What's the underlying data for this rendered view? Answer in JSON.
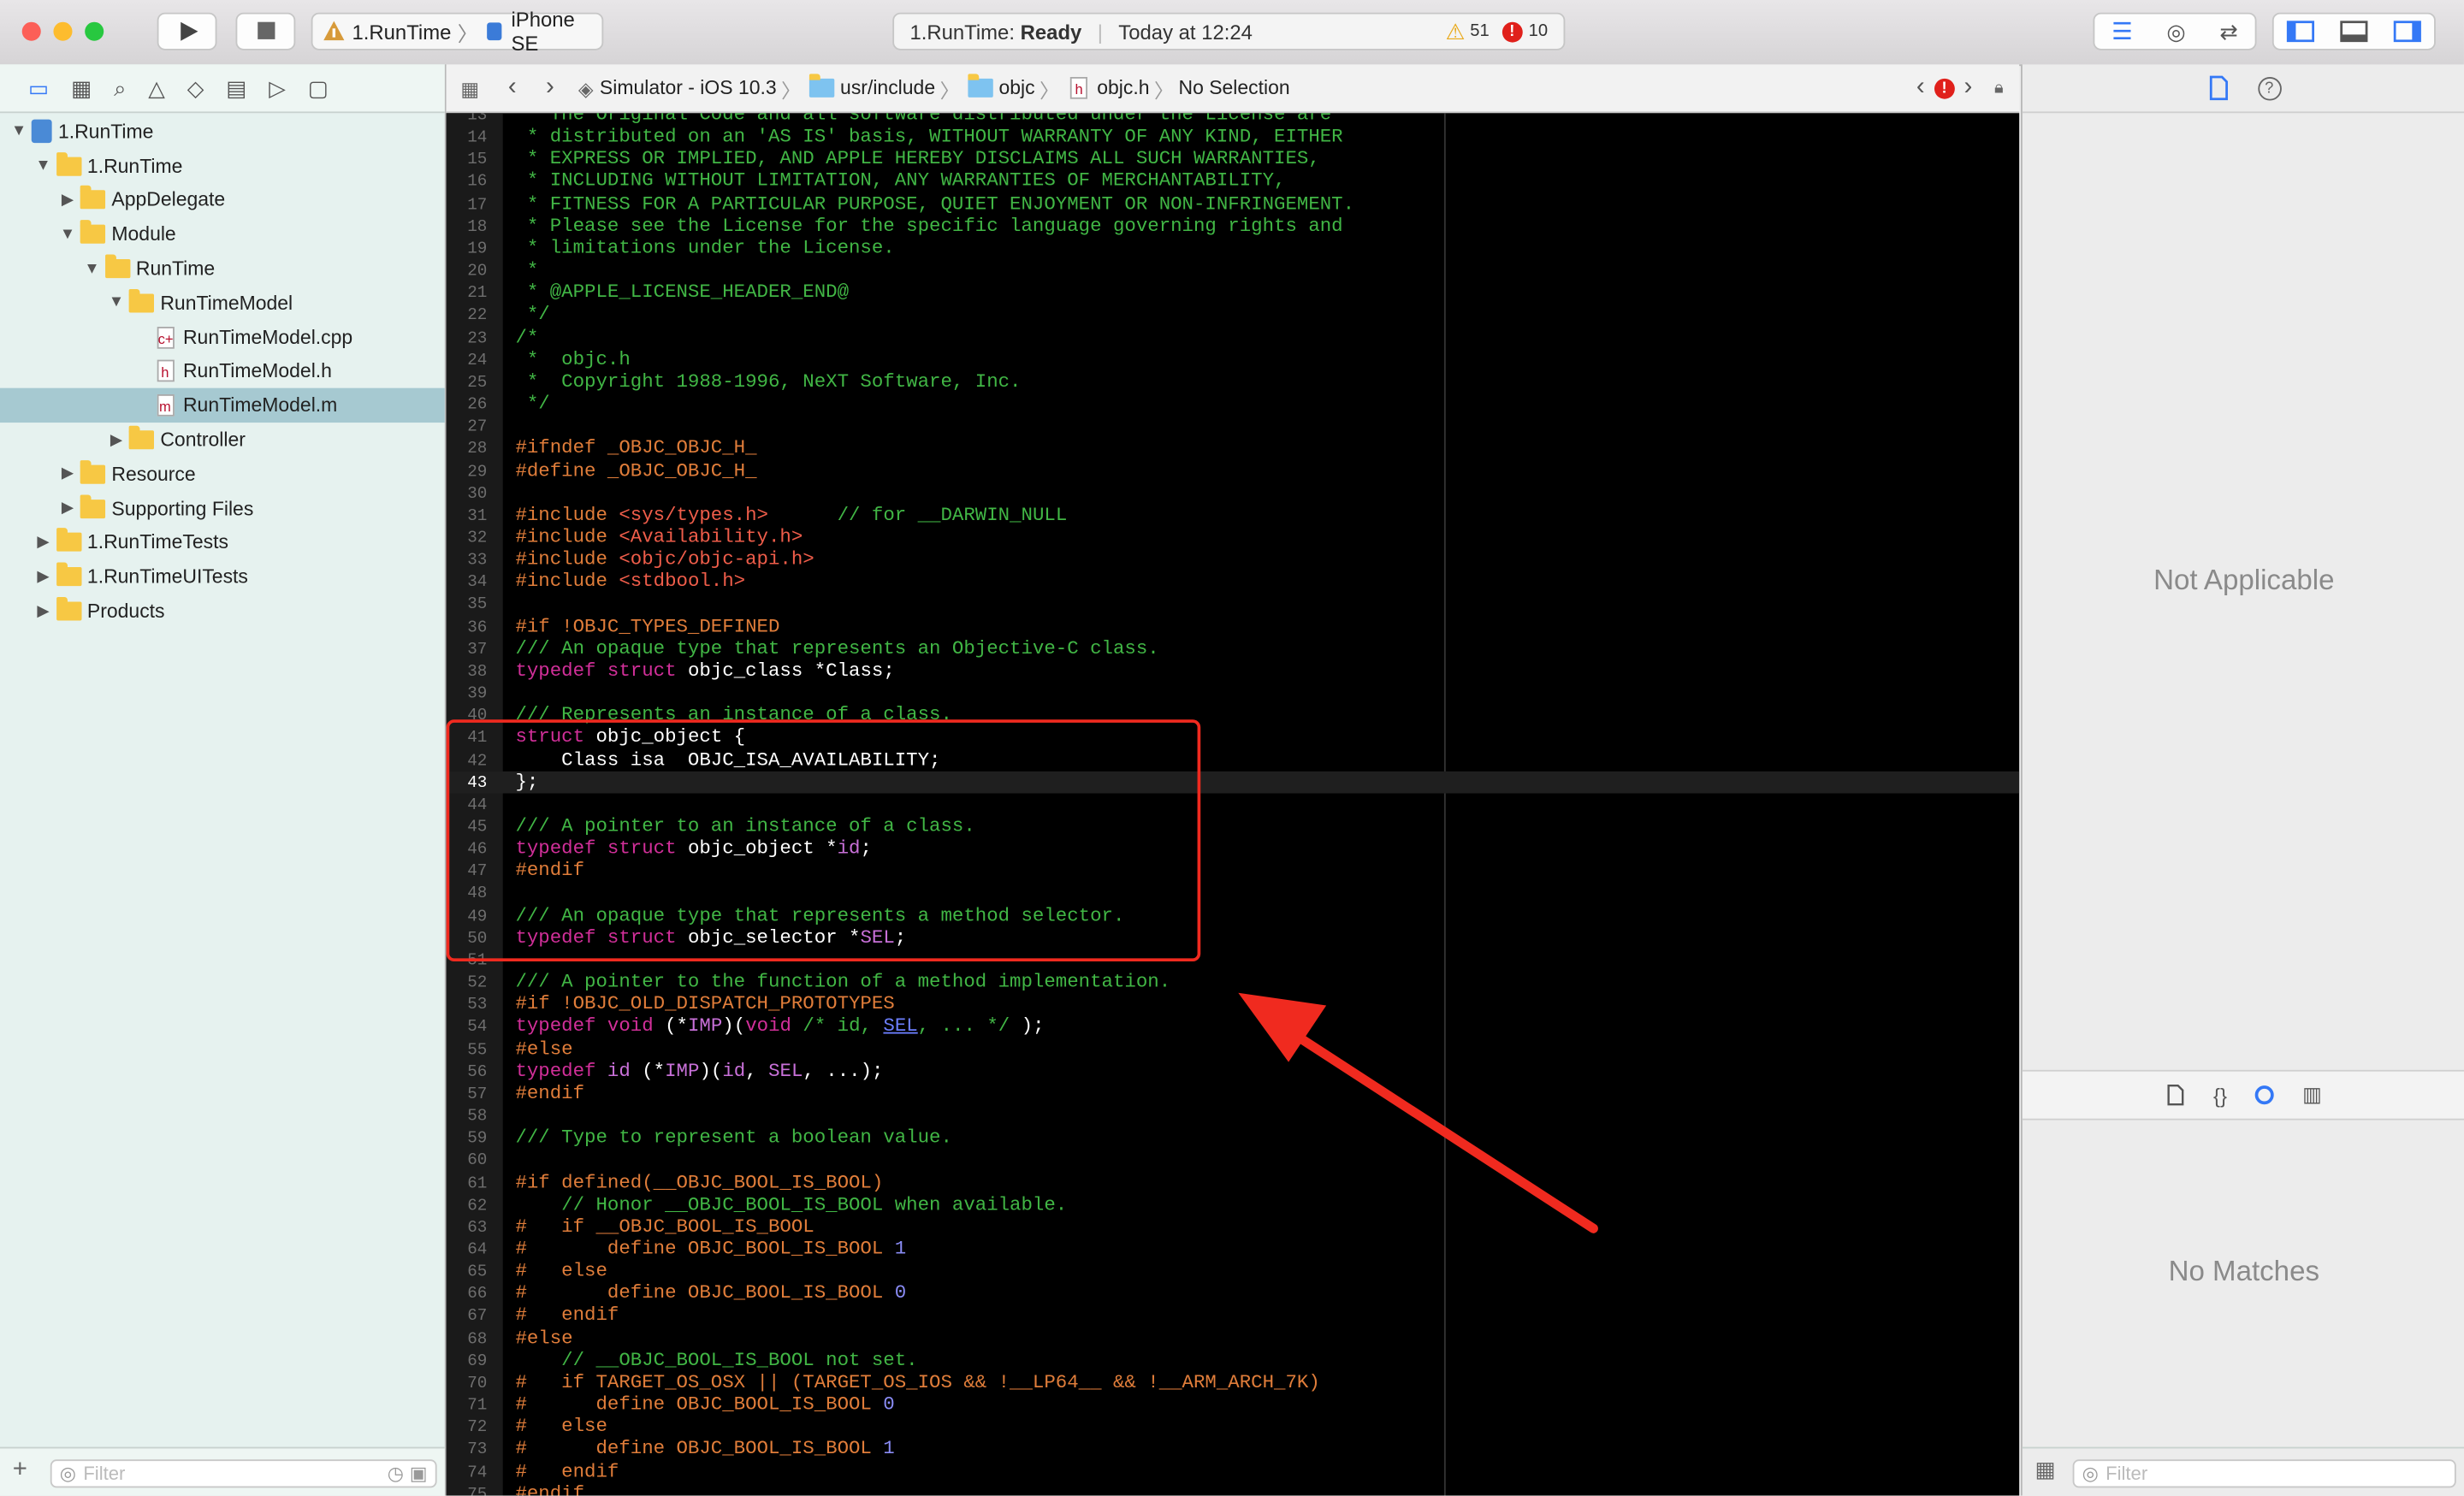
{
  "toolbar": {
    "scheme_target": "1.RunTime",
    "scheme_device": "iPhone SE",
    "status_project": "1.RunTime:",
    "status_state": "Ready",
    "status_time": "Today at 12:24",
    "warnings": "51",
    "errors": "10"
  },
  "navigator": {
    "items": [
      {
        "label": "1.RunTime",
        "kind": "project",
        "indent": 0,
        "open": true
      },
      {
        "label": "1.RunTime",
        "kind": "folder",
        "indent": 1,
        "open": true
      },
      {
        "label": "AppDelegate",
        "kind": "folder",
        "indent": 2,
        "open": false
      },
      {
        "label": "Module",
        "kind": "folder",
        "indent": 2,
        "open": true
      },
      {
        "label": "RunTime",
        "kind": "folder",
        "indent": 3,
        "open": true
      },
      {
        "label": "RunTimeModel",
        "kind": "folder",
        "indent": 4,
        "open": true
      },
      {
        "label": "RunTimeModel.cpp",
        "kind": "file",
        "glyph": "c+",
        "indent": 5
      },
      {
        "label": "RunTimeModel.h",
        "kind": "file",
        "glyph": "h",
        "indent": 5
      },
      {
        "label": "RunTimeModel.m",
        "kind": "file",
        "glyph": "m",
        "indent": 5,
        "selected": true
      },
      {
        "label": "Controller",
        "kind": "folder",
        "indent": 4,
        "open": false
      },
      {
        "label": "Resource",
        "kind": "folder",
        "indent": 2,
        "open": false
      },
      {
        "label": "Supporting Files",
        "kind": "folder",
        "indent": 2,
        "open": false
      },
      {
        "label": "1.RunTimeTests",
        "kind": "folder",
        "indent": 1,
        "open": false
      },
      {
        "label": "1.RunTimeUITests",
        "kind": "folder",
        "indent": 1,
        "open": false
      },
      {
        "label": "Products",
        "kind": "folder",
        "indent": 1,
        "open": false
      }
    ],
    "filter_placeholder": "Filter"
  },
  "jumpbar": {
    "crumbs": [
      "Simulator - iOS 10.3",
      "usr/include",
      "objc",
      "objc.h",
      "No Selection"
    ]
  },
  "editor": {
    "current_line": 43,
    "lines": [
      {
        "n": "13",
        "segs": [
          [
            " * The Original Code and all software distributed under the License are",
            "c"
          ]
        ]
      },
      {
        "n": "14",
        "segs": [
          [
            " * distributed on an 'AS IS' basis, WITHOUT WARRANTY OF ANY KIND, EITHER",
            "c"
          ]
        ]
      },
      {
        "n": "15",
        "segs": [
          [
            " * EXPRESS OR IMPLIED, AND APPLE HEREBY DISCLAIMS ALL SUCH WARRANTIES,",
            "c"
          ]
        ]
      },
      {
        "n": "16",
        "segs": [
          [
            " * INCLUDING WITHOUT LIMITATION, ANY WARRANTIES OF MERCHANTABILITY,",
            "c"
          ]
        ]
      },
      {
        "n": "17",
        "segs": [
          [
            " * FITNESS FOR A PARTICULAR PURPOSE, QUIET ENJOYMENT OR NON-INFRINGEMENT.",
            "c"
          ]
        ]
      },
      {
        "n": "18",
        "segs": [
          [
            " * Please see the License for the specific language governing rights and",
            "c"
          ]
        ]
      },
      {
        "n": "19",
        "segs": [
          [
            " * limitations under the License.",
            "c"
          ]
        ]
      },
      {
        "n": "20",
        "segs": [
          [
            " *",
            "c"
          ]
        ]
      },
      {
        "n": "21",
        "segs": [
          [
            " * @APPLE_LICENSE_HEADER_END@",
            "c"
          ]
        ]
      },
      {
        "n": "22",
        "segs": [
          [
            " */",
            "c"
          ]
        ]
      },
      {
        "n": "23",
        "segs": [
          [
            "/*",
            "c"
          ]
        ]
      },
      {
        "n": "24",
        "segs": [
          [
            " *  objc.h",
            "c"
          ]
        ]
      },
      {
        "n": "25",
        "segs": [
          [
            " *  Copyright 1988-1996, NeXT Software, Inc.",
            "c"
          ]
        ]
      },
      {
        "n": "26",
        "segs": [
          [
            " */",
            "c"
          ]
        ]
      },
      {
        "n": "27",
        "segs": []
      },
      {
        "n": "28",
        "segs": [
          [
            "#ifndef _OBJC_OBJC_H_",
            "p"
          ]
        ]
      },
      {
        "n": "29",
        "segs": [
          [
            "#define _OBJC_OBJC_H_",
            "p"
          ]
        ]
      },
      {
        "n": "30",
        "segs": []
      },
      {
        "n": "31",
        "segs": [
          [
            "#include ",
            "p"
          ],
          [
            "<sys/types.h>",
            "s"
          ],
          [
            "      ",
            "t"
          ],
          [
            "// for __DARWIN_NULL",
            "c"
          ]
        ]
      },
      {
        "n": "32",
        "segs": [
          [
            "#include ",
            "p"
          ],
          [
            "<Availability.h>",
            "s"
          ]
        ]
      },
      {
        "n": "33",
        "segs": [
          [
            "#include ",
            "p"
          ],
          [
            "<objc/objc-api.h>",
            "s"
          ]
        ]
      },
      {
        "n": "34",
        "segs": [
          [
            "#include ",
            "p"
          ],
          [
            "<stdbool.h>",
            "s"
          ]
        ]
      },
      {
        "n": "35",
        "segs": []
      },
      {
        "n": "36",
        "segs": [
          [
            "#if !OBJC_TYPES_DEFINED",
            "p"
          ]
        ]
      },
      {
        "n": "37",
        "segs": [
          [
            "/// An opaque type that represents an Objective-C class.",
            "c"
          ]
        ]
      },
      {
        "n": "38",
        "segs": [
          [
            "typedef ",
            "k"
          ],
          [
            "struct ",
            "k"
          ],
          [
            "objc_class *Class;",
            "t"
          ]
        ]
      },
      {
        "n": "39",
        "segs": []
      },
      {
        "n": "40",
        "segs": [
          [
            "/// Represents an instance of a class.",
            "c"
          ]
        ]
      },
      {
        "n": "41",
        "segs": [
          [
            "struct ",
            "k"
          ],
          [
            "objc_object {",
            "t"
          ]
        ]
      },
      {
        "n": "42",
        "segs": [
          [
            "    Class isa  OBJC_ISA_AVAILABILITY;",
            "t"
          ]
        ]
      },
      {
        "n": "43",
        "segs": [
          [
            "};",
            "t"
          ]
        ]
      },
      {
        "n": "44",
        "segs": []
      },
      {
        "n": "45",
        "segs": [
          [
            "/// A pointer to an instance of a class.",
            "c"
          ]
        ]
      },
      {
        "n": "46",
        "segs": [
          [
            "typedef ",
            "k"
          ],
          [
            "struct ",
            "k"
          ],
          [
            "objc_object *",
            "t"
          ],
          [
            "id",
            "m"
          ],
          [
            ";",
            "t"
          ]
        ]
      },
      {
        "n": "47",
        "segs": [
          [
            "#endif",
            "p"
          ]
        ]
      },
      {
        "n": "48",
        "segs": []
      },
      {
        "n": "49",
        "segs": [
          [
            "/// An opaque type that represents a method selector.",
            "c"
          ]
        ]
      },
      {
        "n": "50",
        "segs": [
          [
            "typedef ",
            "k"
          ],
          [
            "struct ",
            "k"
          ],
          [
            "objc_selector *",
            "t"
          ],
          [
            "SEL",
            "m"
          ],
          [
            ";",
            "t"
          ]
        ]
      },
      {
        "n": "51",
        "segs": []
      },
      {
        "n": "52",
        "segs": [
          [
            "/// A pointer to the function of a method implementation.",
            "c"
          ]
        ]
      },
      {
        "n": "53",
        "segs": [
          [
            "#if !OBJC_OLD_DISPATCH_PROTOTYPES",
            "p"
          ]
        ]
      },
      {
        "n": "54",
        "segs": [
          [
            "typedef ",
            "k"
          ],
          [
            "void ",
            "k"
          ],
          [
            "(*",
            "t"
          ],
          [
            "IMP",
            "m"
          ],
          [
            ")(",
            "t"
          ],
          [
            "void ",
            "k"
          ],
          [
            "/* id, ",
            "c"
          ],
          [
            "SEL",
            "u"
          ],
          [
            ", ... */",
            "c"
          ],
          [
            " );",
            "t"
          ]
        ]
      },
      {
        "n": "55",
        "segs": [
          [
            "#else",
            "p"
          ]
        ]
      },
      {
        "n": "56",
        "segs": [
          [
            "typedef ",
            "k"
          ],
          [
            "id ",
            "m"
          ],
          [
            "(*",
            "t"
          ],
          [
            "IMP",
            "m"
          ],
          [
            ")(",
            "t"
          ],
          [
            "id",
            "m"
          ],
          [
            ", ",
            "t"
          ],
          [
            "SEL",
            "m"
          ],
          [
            ", ...);",
            "t"
          ]
        ]
      },
      {
        "n": "57",
        "segs": [
          [
            "#endif",
            "p"
          ]
        ]
      },
      {
        "n": "58",
        "segs": []
      },
      {
        "n": "59",
        "segs": [
          [
            "/// Type to represent a boolean value.",
            "c"
          ]
        ]
      },
      {
        "n": "60",
        "segs": []
      },
      {
        "n": "61",
        "segs": [
          [
            "#if defined(__OBJC_BOOL_IS_BOOL)",
            "p"
          ]
        ]
      },
      {
        "n": "62",
        "segs": [
          [
            "    // Honor __OBJC_BOOL_IS_BOOL when available.",
            "c"
          ]
        ]
      },
      {
        "n": "63",
        "segs": [
          [
            "#   if __OBJC_BOOL_IS_BOOL",
            "p"
          ]
        ]
      },
      {
        "n": "64",
        "segs": [
          [
            "#       define OBJC_BOOL_IS_BOOL ",
            "p"
          ],
          [
            "1",
            "num"
          ]
        ]
      },
      {
        "n": "65",
        "segs": [
          [
            "#   else",
            "p"
          ]
        ]
      },
      {
        "n": "66",
        "segs": [
          [
            "#       define OBJC_BOOL_IS_BOOL ",
            "p"
          ],
          [
            "0",
            "num"
          ]
        ]
      },
      {
        "n": "67",
        "segs": [
          [
            "#   endif",
            "p"
          ]
        ]
      },
      {
        "n": "68",
        "segs": [
          [
            "#else",
            "p"
          ]
        ]
      },
      {
        "n": "69",
        "segs": [
          [
            "    // __OBJC_BOOL_IS_BOOL not set.",
            "c"
          ]
        ]
      },
      {
        "n": "70",
        "segs": [
          [
            "#   if TARGET_OS_OSX || (TARGET_OS_IOS && !__LP64__ && !__ARM_ARCH_7K)",
            "p"
          ]
        ]
      },
      {
        "n": "71",
        "segs": [
          [
            "#      define OBJC_BOOL_IS_BOOL ",
            "p"
          ],
          [
            "0",
            "num"
          ]
        ]
      },
      {
        "n": "72",
        "segs": [
          [
            "#   else",
            "p"
          ]
        ]
      },
      {
        "n": "73",
        "segs": [
          [
            "#      define OBJC_BOOL_IS_BOOL ",
            "p"
          ],
          [
            "1",
            "num"
          ]
        ]
      },
      {
        "n": "74",
        "segs": [
          [
            "#   endif",
            "p"
          ]
        ]
      },
      {
        "n": "75",
        "segs": [
          [
            "#endif",
            "p"
          ]
        ]
      }
    ]
  },
  "inspector": {
    "top_message": "Not Applicable",
    "bottom_message": "No Matches",
    "filter_placeholder": "Filter"
  },
  "colors": {
    "highlight_box": "#f02a1f",
    "arrow": "#f02a1f",
    "selection": "#a6c9d1"
  }
}
